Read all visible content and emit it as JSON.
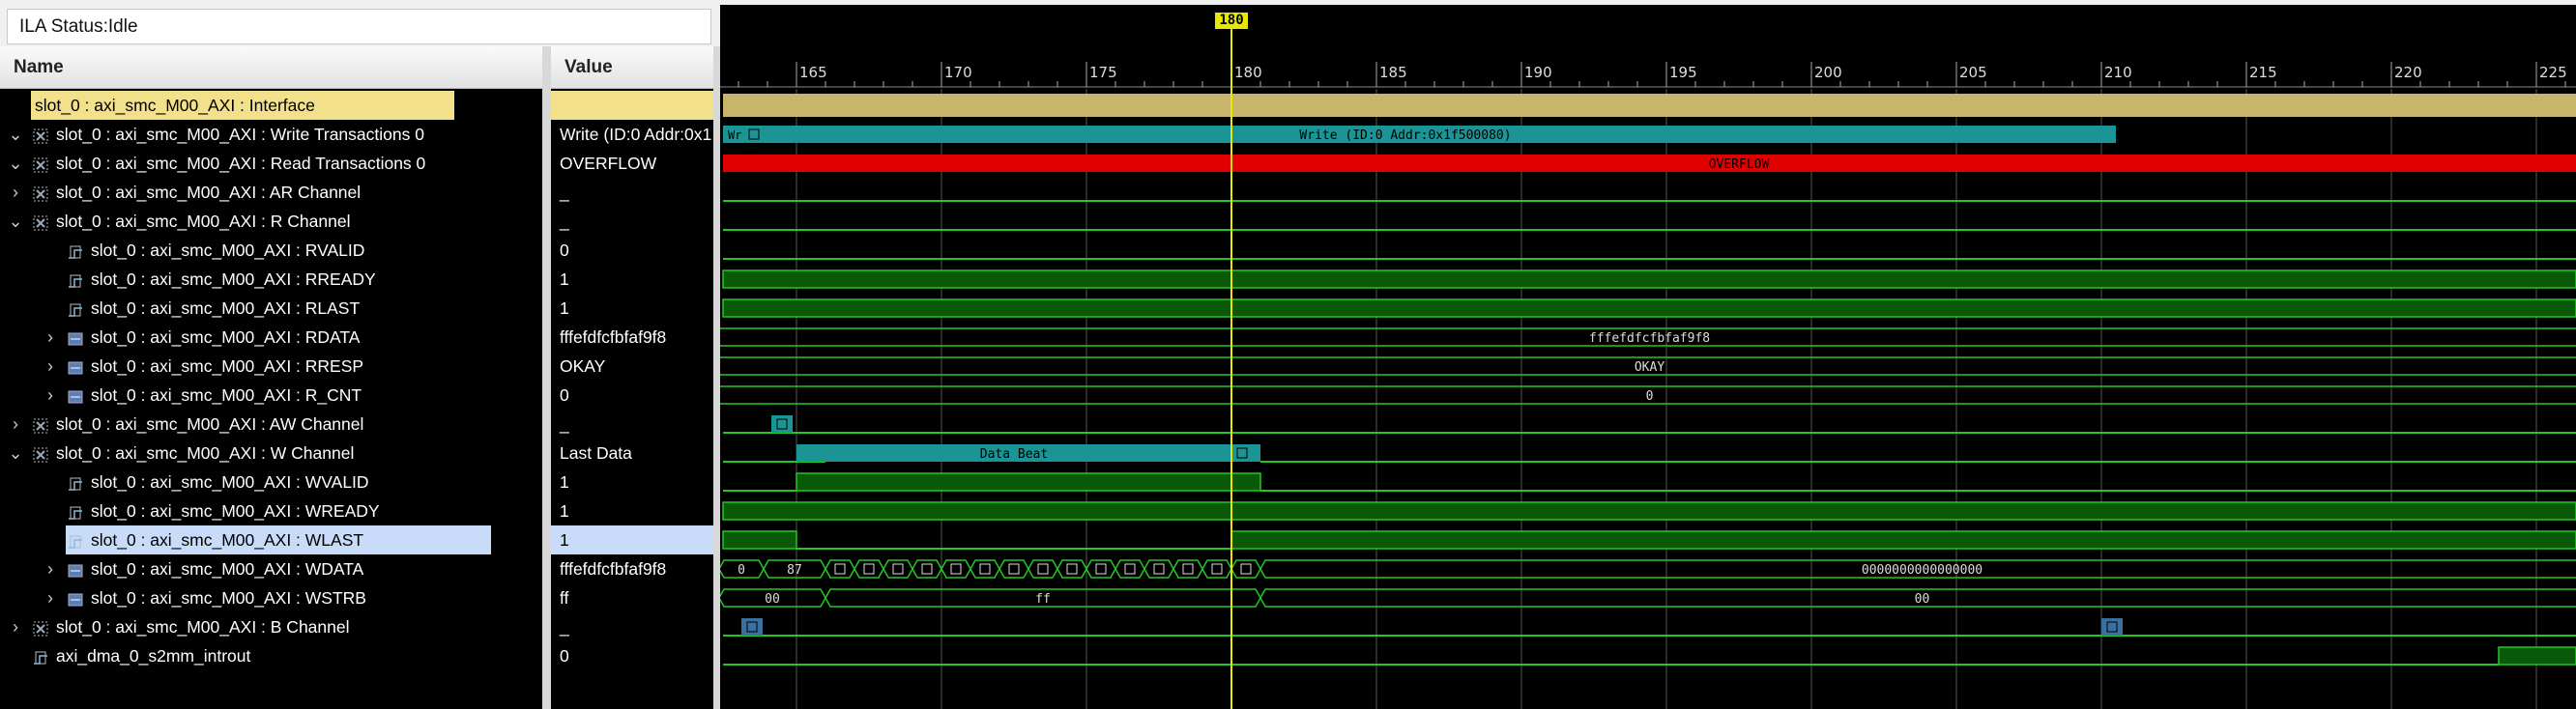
{
  "status": {
    "text": "ILA Status:Idle"
  },
  "columns": {
    "name": "Name",
    "value": "Value"
  },
  "signals": [
    {
      "name": "slot_0 : axi_smc_M00_AXI : Interface",
      "value": "",
      "indent": 0,
      "expand": "",
      "icon": "interface"
    },
    {
      "name": "slot_0 : axi_smc_M00_AXI : Write Transactions 0",
      "value": "Write (ID:0 Addr:0x1",
      "indent": 0,
      "expand": "open",
      "icon": "group"
    },
    {
      "name": "slot_0 : axi_smc_M00_AXI : Read Transactions 0",
      "value": "OVERFLOW",
      "indent": 0,
      "expand": "open",
      "icon": "group"
    },
    {
      "name": "slot_0 : axi_smc_M00_AXI : AR Channel",
      "value": "_",
      "indent": 0,
      "expand": "closed",
      "icon": "group"
    },
    {
      "name": "slot_0 : axi_smc_M00_AXI : R Channel",
      "value": "_",
      "indent": 0,
      "expand": "open",
      "icon": "group"
    },
    {
      "name": "slot_0 : axi_smc_M00_AXI : RVALID",
      "value": "0",
      "indent": 1,
      "expand": "",
      "icon": "bit"
    },
    {
      "name": "slot_0 : axi_smc_M00_AXI : RREADY",
      "value": "1",
      "indent": 1,
      "expand": "",
      "icon": "bit"
    },
    {
      "name": "slot_0 : axi_smc_M00_AXI : RLAST",
      "value": "1",
      "indent": 1,
      "expand": "",
      "icon": "bit"
    },
    {
      "name": "slot_0 : axi_smc_M00_AXI : RDATA",
      "value": "fffefdfcfbfaf9f8",
      "indent": 1,
      "expand": "closed",
      "icon": "bus"
    },
    {
      "name": "slot_0 : axi_smc_M00_AXI : RRESP",
      "value": "OKAY",
      "indent": 1,
      "expand": "closed",
      "icon": "bus"
    },
    {
      "name": "slot_0 : axi_smc_M00_AXI : R_CNT",
      "value": "0",
      "indent": 1,
      "expand": "closed",
      "icon": "bus"
    },
    {
      "name": "slot_0 : axi_smc_M00_AXI : AW Channel",
      "value": "_",
      "indent": 0,
      "expand": "closed",
      "icon": "group"
    },
    {
      "name": "slot_0 : axi_smc_M00_AXI : W Channel",
      "value": "Last Data",
      "indent": 0,
      "expand": "open",
      "icon": "group"
    },
    {
      "name": "slot_0 : axi_smc_M00_AXI : WVALID",
      "value": "1",
      "indent": 1,
      "expand": "",
      "icon": "bit"
    },
    {
      "name": "slot_0 : axi_smc_M00_AXI : WREADY",
      "value": "1",
      "indent": 1,
      "expand": "",
      "icon": "bit"
    },
    {
      "name": "slot_0 : axi_smc_M00_AXI : WLAST",
      "value": "1",
      "indent": 1,
      "expand": "",
      "icon": "bit",
      "selected": true
    },
    {
      "name": "slot_0 : axi_smc_M00_AXI : WDATA",
      "value": "fffefdfcfbfaf9f8",
      "indent": 1,
      "expand": "closed",
      "icon": "bus"
    },
    {
      "name": "slot_0 : axi_smc_M00_AXI : WSTRB",
      "value": "ff",
      "indent": 1,
      "expand": "closed",
      "icon": "bus"
    },
    {
      "name": "slot_0 : axi_smc_M00_AXI : B Channel",
      "value": "_",
      "indent": 0,
      "expand": "closed",
      "icon": "group"
    },
    {
      "name": "axi_dma_0_s2mm_introut",
      "value": "0",
      "indent": 0,
      "expand": "",
      "icon": "bit"
    }
  ],
  "waveform": {
    "cursor_time": "180",
    "time_ticks": [
      "165",
      "170",
      "175",
      "180",
      "185",
      "190",
      "195",
      "200",
      "205",
      "210",
      "215",
      "220",
      "225"
    ],
    "labels": {
      "write_txn": "Write (ID:0 Addr:0x1f500080)",
      "write_txn_short": "Wr",
      "read_txn": "OVERFLOW",
      "rdata": "fffefdfcfbfaf9f8",
      "rresp": "OKAY",
      "r_cnt": "0",
      "w_channel": "Data Beat",
      "wdata_first": "0",
      "wdata_second": "87",
      "wdata_after": "0000000000000000",
      "wstrb_first": "00",
      "wstrb_mid": "ff",
      "wstrb_after": "00"
    },
    "colors": {
      "interface": "#c8b46a",
      "transaction": "#1a9494",
      "overflow": "#e00000",
      "bit_fill": "#0a5a0a",
      "line": "#22c722",
      "cursor": "#e8e800",
      "grid": "#555555"
    }
  }
}
